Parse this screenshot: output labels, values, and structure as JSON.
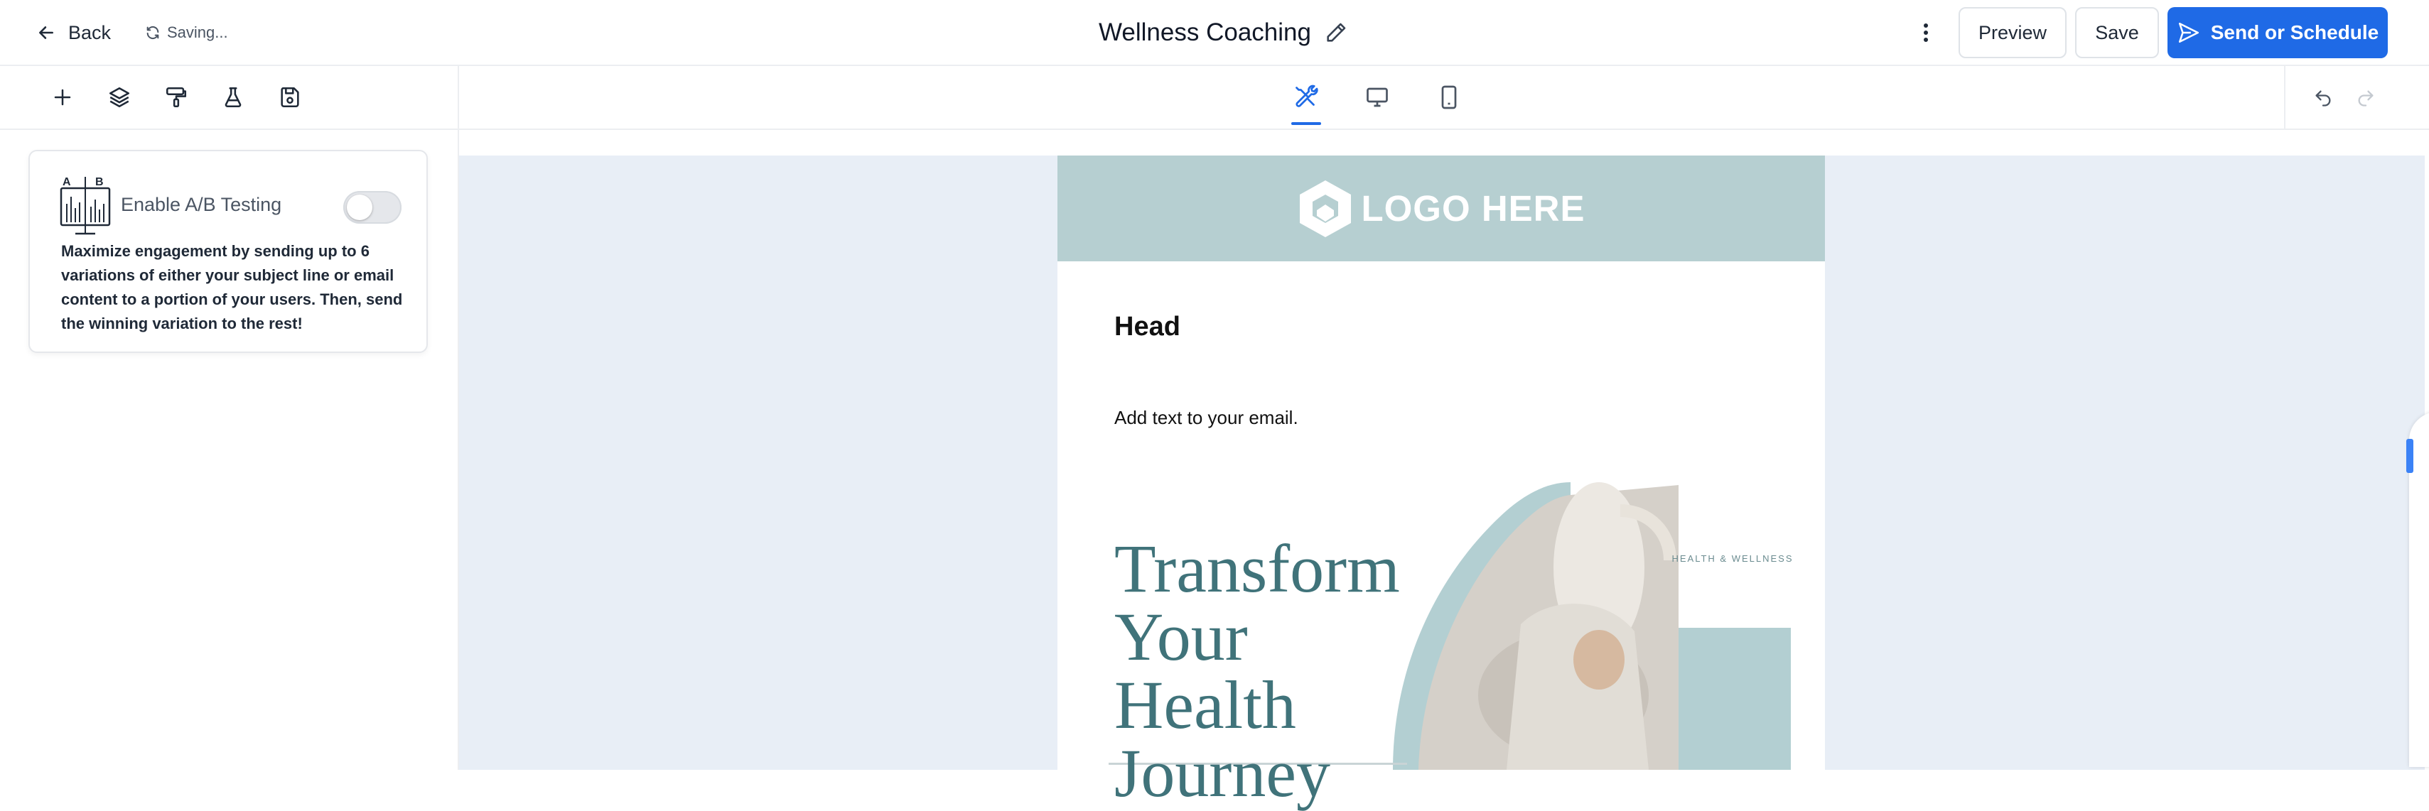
{
  "header": {
    "back_label": "Back",
    "saving_label": "Saving...",
    "title": "Wellness Coaching",
    "preview_label": "Preview",
    "save_label": "Save",
    "send_label": "Send or Schedule",
    "accent_color": "#1f6ae6"
  },
  "toolbar": {
    "tools": [
      "add-icon",
      "layers-icon",
      "paint-roller-icon",
      "flask-icon",
      "save-disk-icon"
    ]
  },
  "ab_testing": {
    "icon_letters": [
      "A",
      "B"
    ],
    "title": "Enable A/B Testing",
    "enabled": false,
    "description": "Maximize engagement by sending up to 6 variations of either your subject line or email content to a portion of your users. Then, send the winning variation to the rest!"
  },
  "view_tabs": [
    {
      "name": "edit-tools-icon",
      "active": true
    },
    {
      "name": "desktop-icon",
      "active": false
    },
    {
      "name": "mobile-icon",
      "active": false
    }
  ],
  "email": {
    "logo_text": "LOGO HERE",
    "heading": "Head",
    "body_text": "Add text to your email.",
    "hero_title": "Transform\nYour Health\nJourney",
    "badge_text": "HEALTH & WELLNESS",
    "header_color": "#b6cfd1",
    "hero_accent_color": "#b3cfd2",
    "hero_text_color": "#40737a"
  }
}
